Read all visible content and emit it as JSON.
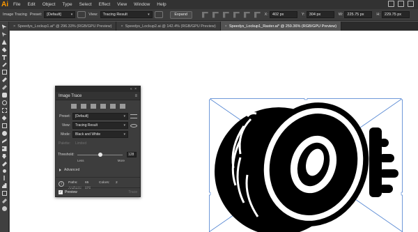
{
  "app": {
    "logo_text": "Ai",
    "menu": [
      "File",
      "Edit",
      "Object",
      "Type",
      "Select",
      "Effect",
      "View",
      "Window",
      "Help"
    ]
  },
  "control_bar": {
    "image_tracing_label": "Image Tracing",
    "preset_label": "Preset:",
    "preset_value": "[Default]",
    "view_label": "View:",
    "view_value": "Tracing Result",
    "expand_label": "Expand",
    "x_label": "X:",
    "x_value": "402 px",
    "y_label": "Y:",
    "y_value": "304 px",
    "w_label": "W:",
    "w_value": "225.75 px",
    "h_label": "H:",
    "h_value": "229.75 px"
  },
  "tabs": [
    {
      "label": "Speedys_Lockup1.ai* @ 296.33% (RGB/GPU Preview)",
      "active": false
    },
    {
      "label": "Speedys_Lockup2.ai @ 142.4% (RGB/GPU Preview)",
      "active": false
    },
    {
      "label": "Speedys_Lockup1_Raster.ai* @ 259.36% (RGB/GPU Preview)",
      "active": true
    }
  ],
  "image_trace": {
    "title": "Image Trace",
    "preset_label": "Preset:",
    "preset_value": "[Default]",
    "view_label": "View:",
    "view_value": "Tracing Result",
    "mode_label": "Mode:",
    "mode_value": "Black and White",
    "palette_label": "Palette:",
    "palette_value": "Limited",
    "threshold_label": "Threshold:",
    "threshold_value": "128",
    "threshold_fraction": 0.5,
    "less_label": "Less",
    "more_label": "More",
    "advanced_label": "Advanced",
    "paths_label": "Paths:",
    "paths_value": "65",
    "anchors_label": "Anchors:",
    "anchors_value": "970",
    "colors_label": "Colors:",
    "colors_value": "2",
    "preview_label": "Preview",
    "preview_checked": true,
    "trace_label": "Trace"
  },
  "colors": {
    "accent": "#ff9a00",
    "selection": "#4a7fd0"
  }
}
